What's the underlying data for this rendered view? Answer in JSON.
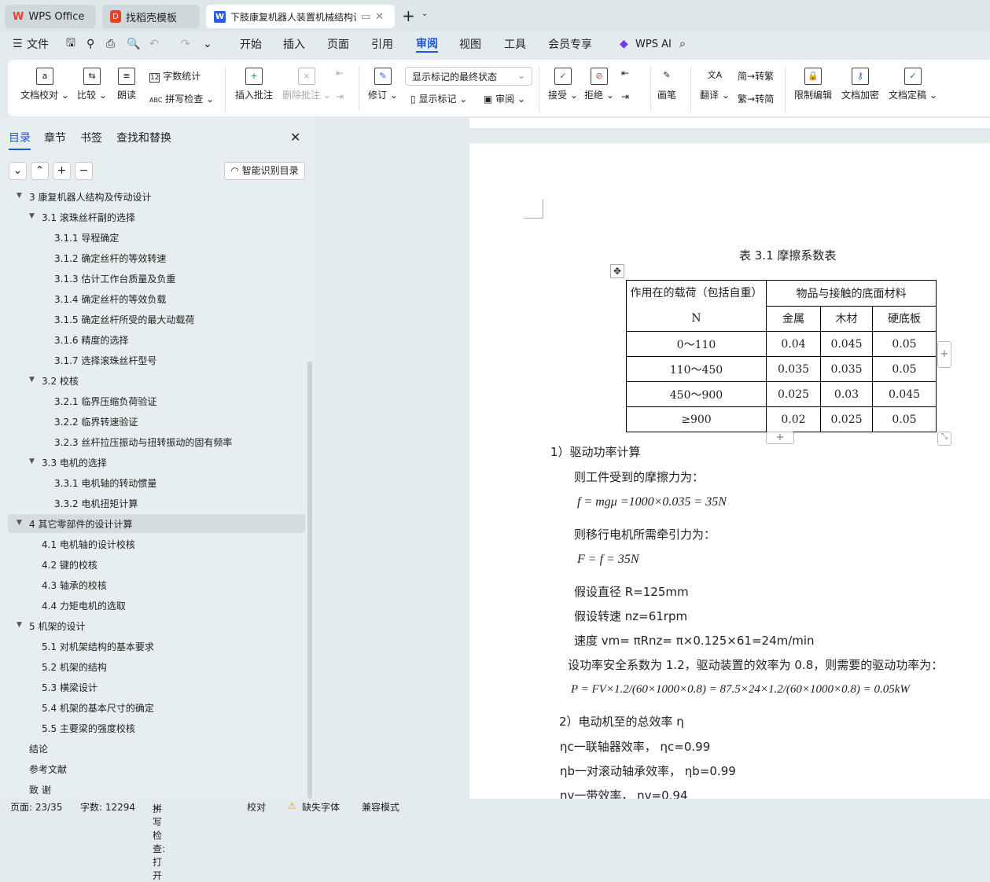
{
  "tabs": [
    {
      "label": "WPS Office",
      "icon": "wps-logo-icon"
    },
    {
      "label": "找稻壳模板",
      "icon": "docer-icon"
    },
    {
      "label": "下肢康复机器人装置机械结构设",
      "icon": "word-doc-icon"
    }
  ],
  "menu": {
    "file": "文件",
    "items": [
      "开始",
      "插入",
      "页面",
      "引用",
      "审阅",
      "视图",
      "工具",
      "会员专享"
    ],
    "active": "审阅",
    "wps_ai": "WPS AI"
  },
  "ribbon": {
    "proofread": "文档校对",
    "compare": "比较",
    "read_aloud": "朗读",
    "word_count": "字数统计",
    "spell_check": "拼写检查",
    "insert_comment": "插入批注",
    "delete_comment": "删除批注",
    "revise": "修订",
    "markup_state": "显示标记的最终状态",
    "show_markup": "显示标记",
    "review": "审阅",
    "accept": "接受",
    "reject": "拒绝",
    "pen": "画笔",
    "translate": "翻译",
    "to_traditional": "转繁",
    "to_simplified": "转简",
    "restrict_edit": "限制编辑",
    "encrypt": "文档加密",
    "finalize": "文档定稿"
  },
  "sidebar": {
    "tabs": [
      "目录",
      "章节",
      "书签",
      "查找和替换"
    ],
    "active_tab": "目录",
    "smart_toc": "智能识别目录",
    "items": [
      {
        "level": 1,
        "label": "3   康复机器人结构及传动设计",
        "expanded": true
      },
      {
        "level": 2,
        "label": "3.1  滚珠丝杆副的选择",
        "expanded": true
      },
      {
        "level": 3,
        "label": "3.1.1 导程确定"
      },
      {
        "level": 3,
        "label": "3.1.2 确定丝杆的等效转速"
      },
      {
        "level": 3,
        "label": "3.1.3 估计工作台质量及负重"
      },
      {
        "level": 3,
        "label": "3.1.4 确定丝杆的等效负载"
      },
      {
        "level": 3,
        "label": "3.1.5 确定丝杆所受的最大动载荷"
      },
      {
        "level": 3,
        "label": "3.1.6 精度的选择"
      },
      {
        "level": 3,
        "label": "3.1.7 选择滚珠丝杆型号"
      },
      {
        "level": 2,
        "label": "3.2 校核",
        "expanded": true
      },
      {
        "level": 3,
        "label": "3.2.1  临界压缩负荷验证"
      },
      {
        "level": 3,
        "label": "3.2.2 临界转速验证"
      },
      {
        "level": 3,
        "label": "3.2.3 丝杆拉压振动与扭转振动的固有频率"
      },
      {
        "level": 2,
        "label": "3.3 电机的选择",
        "expanded": true
      },
      {
        "level": 3,
        "label": "3.3.1 电机轴的转动惯量"
      },
      {
        "level": 3,
        "label": "3.3.2 电机扭矩计算"
      },
      {
        "level": 1,
        "label": "4   其它零部件的设计计算",
        "expanded": true,
        "selected": true
      },
      {
        "level": 2,
        "label": "4.1 电机轴的设计校核"
      },
      {
        "level": 2,
        "label": "4.2 键的校核"
      },
      {
        "level": 2,
        "label": "4.3 轴承的校核"
      },
      {
        "level": 2,
        "label": "4.4 力矩电机的选取"
      },
      {
        "level": 1,
        "label": "5  机架的设计",
        "expanded": true
      },
      {
        "level": 2,
        "label": "5.1 对机架结构的基本要求"
      },
      {
        "level": 2,
        "label": "5.2 机架的结构"
      },
      {
        "level": 2,
        "label": "5.3 横梁设计"
      },
      {
        "level": 2,
        "label": "5.4 机架的基本尺寸的确定"
      },
      {
        "level": 2,
        "label": "5.5 主要梁的强度校核"
      },
      {
        "level": 1,
        "label": "结论"
      },
      {
        "level": 1,
        "label": "参考文献"
      },
      {
        "level": 1,
        "label": "致  谢"
      }
    ]
  },
  "document": {
    "table_caption": "表 3.1  摩擦系数表",
    "table": {
      "header_col1": "作用在的载荷（包括自重） N",
      "header_group": "物品与接触的底面材料",
      "subheaders": [
        "金属",
        "木材",
        "硬底板"
      ],
      "rows": [
        [
          "0～110",
          "0.04",
          "0.045",
          "0.05"
        ],
        [
          "110～450",
          "0.035",
          "0.035",
          "0.05"
        ],
        [
          "450～900",
          "0.025",
          "0.03",
          "0.045"
        ],
        [
          "≥900",
          "0.02",
          "0.025",
          "0.05"
        ]
      ]
    },
    "lines": [
      "1）驱动功率计算",
      "则工件受到的摩擦力为：",
      "f = mgμ =1000×0.035 = 35N",
      "则移行电机所需牵引力为：",
      "F = f = 35N",
      "假设直径 R=125mm",
      "假设转速 nz=61rpm",
      "速度 vm= πRnz= π×0.125×61=24m/min",
      "设功率安全系数为 1.2，驱动装置的效率为 0.8，则需要的驱动功率为：",
      "P = FV×1.2/(60×1000×0.8) = 87.5×24×1.2/(60×1000×0.8) = 0.05kW",
      "2）电动机至的总效率 η",
      "ηc一联轴器效率，  ηc=0.99",
      "ηb一对滚动轴承效率，  ηb=0.99",
      "ηv一带效率，  ηv=0.94"
    ]
  },
  "status": {
    "page": "页面: 23/35",
    "words": "字数: 12294",
    "spell": "拼写检查: 打开",
    "proof": "校对",
    "missing_font": "缺失字体",
    "compat": "兼容模式"
  },
  "colors": {
    "accent": "#1f5bd8",
    "wps_red": "#e8402a"
  }
}
